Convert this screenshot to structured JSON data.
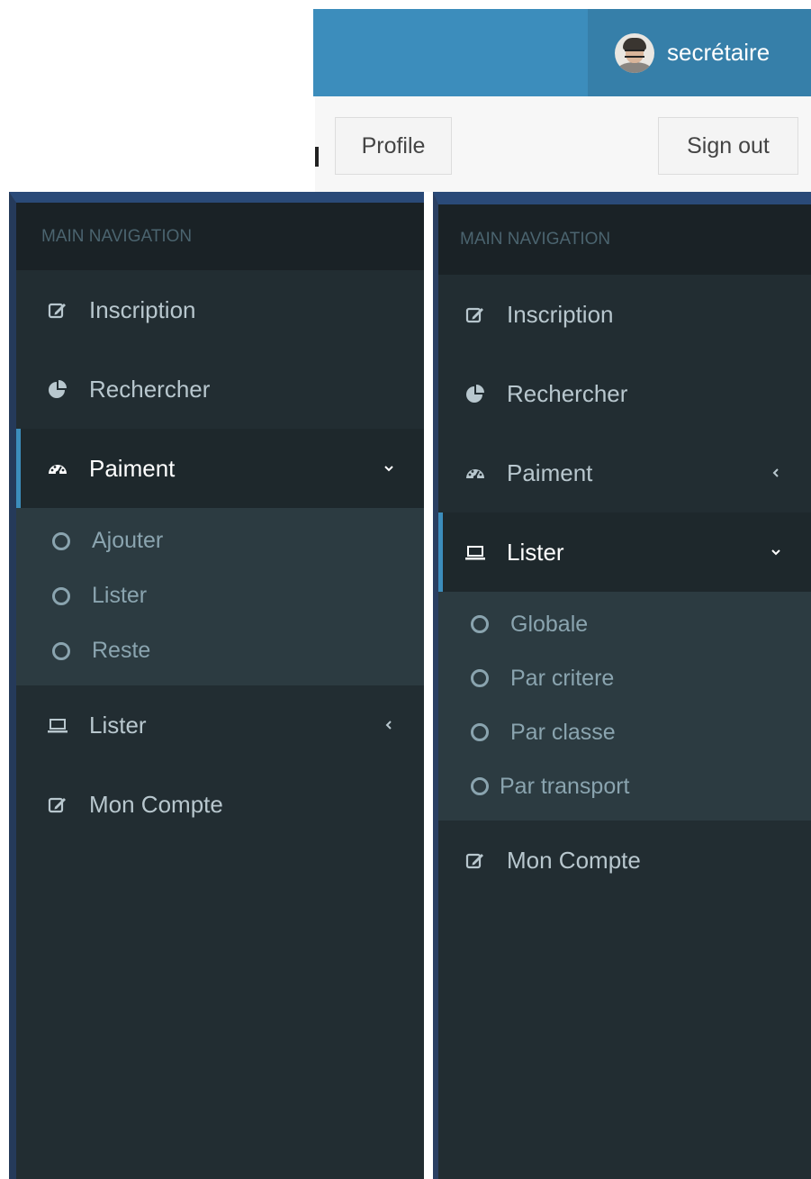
{
  "header": {
    "username": "secrétaire",
    "avatar_icon": "user-avatar",
    "accent_color": "#3c8dbc"
  },
  "user_footer": {
    "profile_label": "Profile",
    "signout_label": "Sign out"
  },
  "sidebar_left": {
    "header": "MAIN NAVIGATION",
    "items": [
      {
        "label": "Inscription",
        "icon": "edit-icon"
      },
      {
        "label": "Rechercher",
        "icon": "pie-chart-icon"
      },
      {
        "label": "Paiment",
        "icon": "dashboard-icon",
        "expanded": true,
        "children": [
          "Ajouter",
          "Lister",
          "Reste"
        ]
      },
      {
        "label": "Lister",
        "icon": "laptop-icon",
        "expanded": false
      },
      {
        "label": "Mon Compte",
        "icon": "edit-icon"
      }
    ]
  },
  "sidebar_right": {
    "header": "MAIN NAVIGATION",
    "items": [
      {
        "label": "Inscription",
        "icon": "edit-icon"
      },
      {
        "label": "Rechercher",
        "icon": "pie-chart-icon"
      },
      {
        "label": "Paiment",
        "icon": "dashboard-icon",
        "expanded": false
      },
      {
        "label": "Lister",
        "icon": "laptop-icon",
        "expanded": true,
        "children": [
          "Globale",
          "Par critere",
          "Par classe",
          "Par transport"
        ]
      },
      {
        "label": "Mon Compte",
        "icon": "edit-icon"
      }
    ]
  }
}
